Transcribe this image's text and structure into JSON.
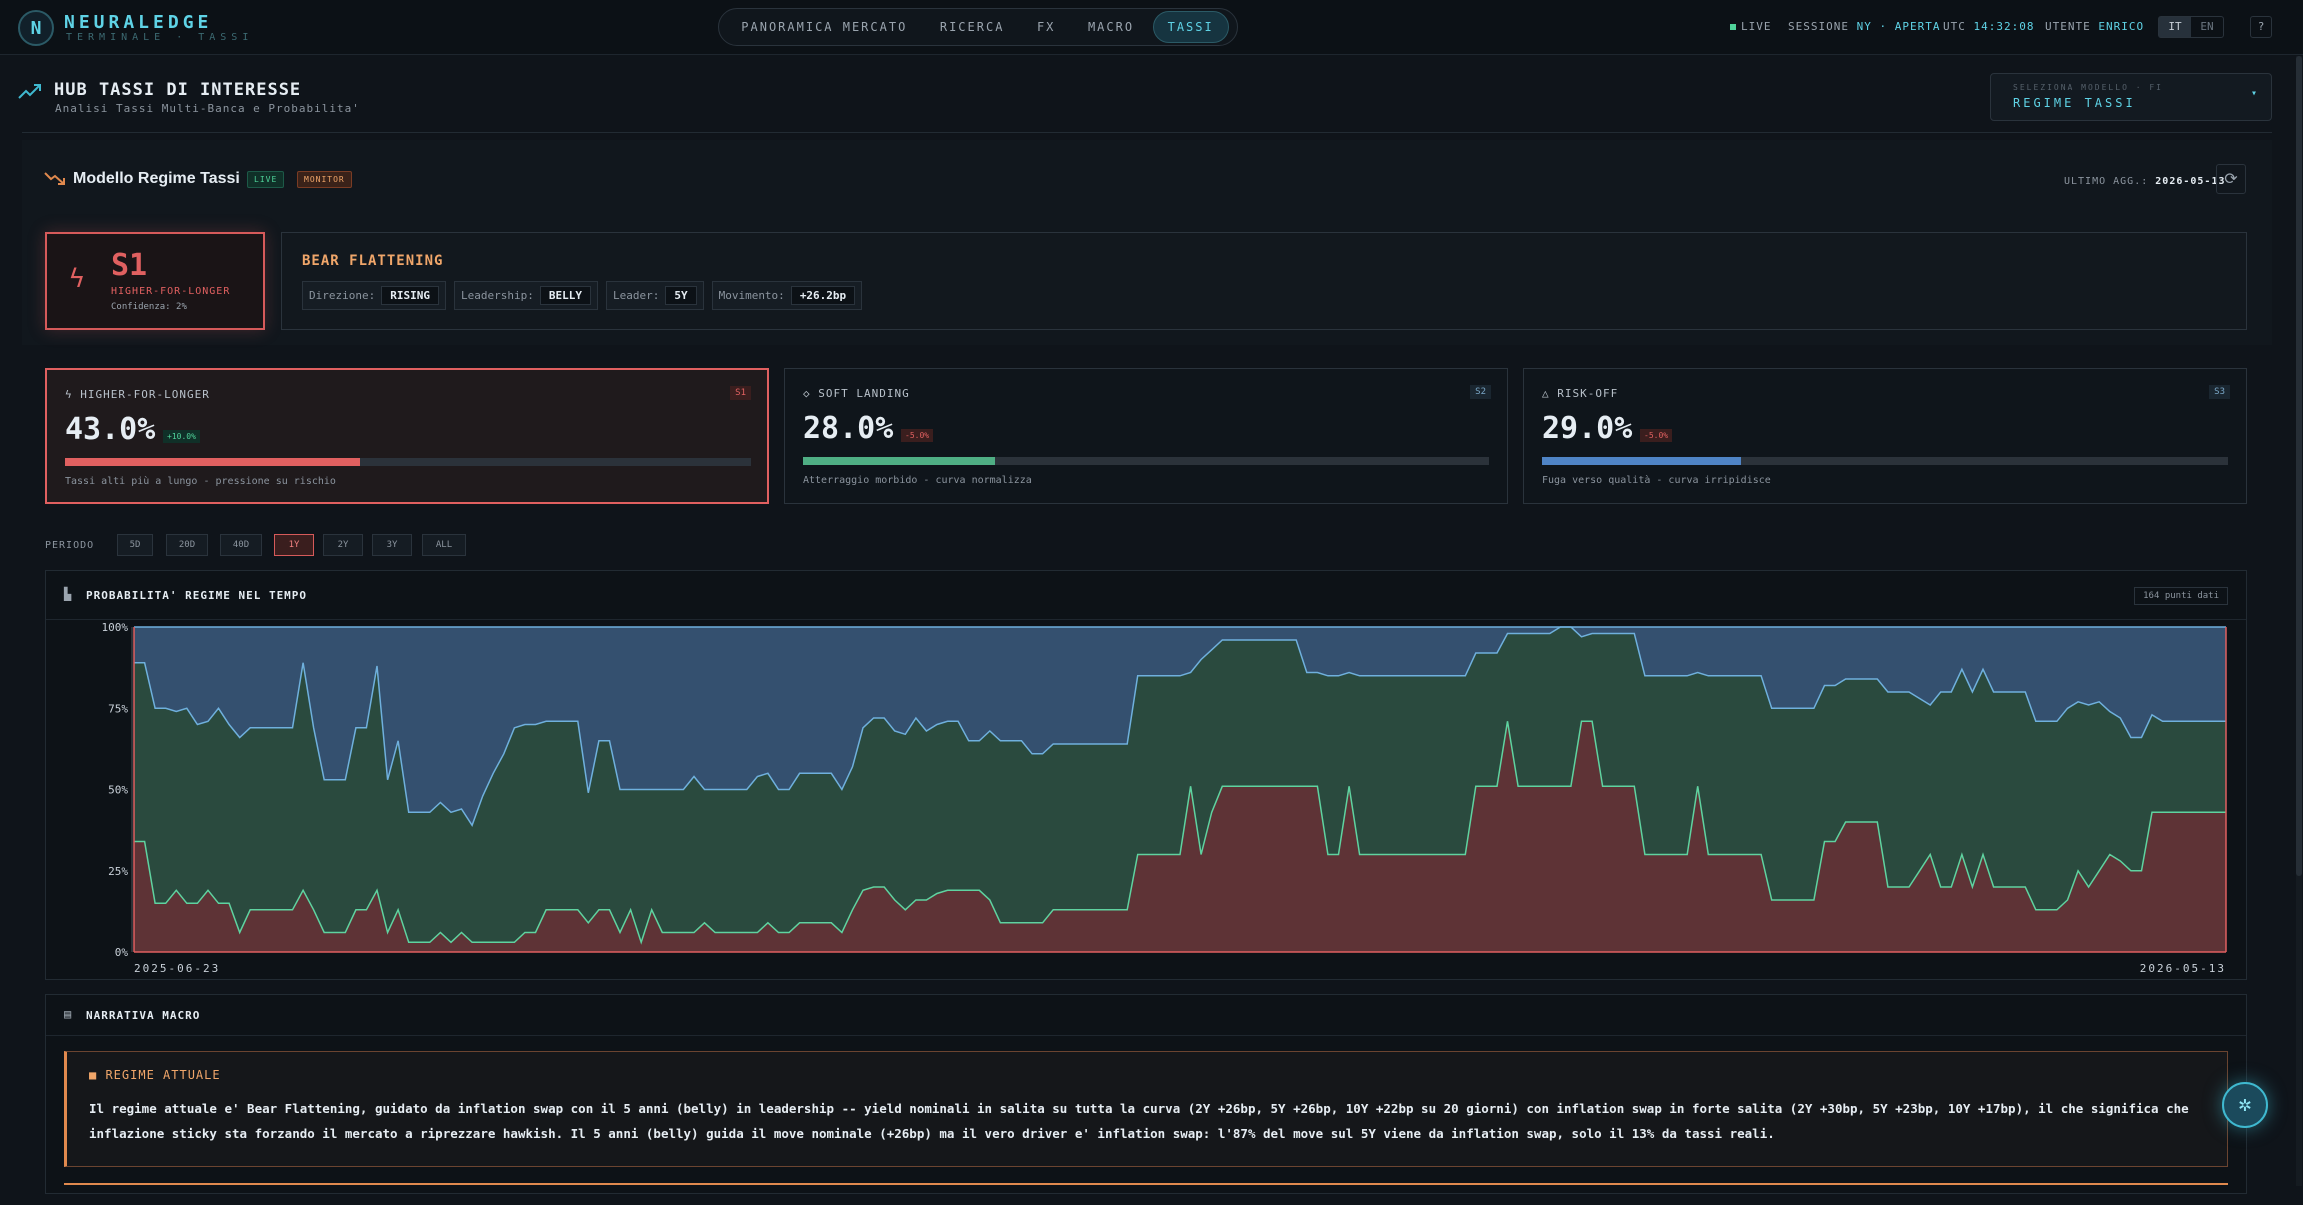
{
  "brand": {
    "name": "NEURALEDGE",
    "sub": "TERMINALE · TASSI",
    "logo": "N"
  },
  "nav": {
    "tabs": [
      "PANORAMICA MERCATO",
      "RICERCA",
      "FX",
      "MACRO",
      "TASSI"
    ],
    "active": "TASSI"
  },
  "status": {
    "live": "LIVE",
    "session_label": "SESSIONE",
    "session_value": "NY · APERTA",
    "utc_label": "UTC",
    "utc_value": "14:32:08",
    "user_label": "UTENTE",
    "user_value": "ENRICO",
    "lang_it": "IT",
    "lang_en": "EN",
    "help": "?"
  },
  "header": {
    "title": "HUB TASSI DI INTERESSE",
    "subtitle": "Analisi Tassi Multi-Banca e Probabilita'",
    "model_label": "SELEZIONA MODELLO · FI",
    "model_value": "REGIME TASSI"
  },
  "model": {
    "title": "Modello Regime Tassi",
    "badge_live": "LIVE",
    "badge_monitor": "MONITOR",
    "updated_label": "ULTIMO AGG.:",
    "updated_value": "2026-05-13"
  },
  "current": {
    "code": "S1",
    "name": "HIGHER-FOR-LONGER",
    "confidence": "Confidenza: 2%"
  },
  "shape": {
    "title": "BEAR FLATTENING",
    "pills": [
      {
        "label": "Direzione:",
        "value": "RISING"
      },
      {
        "label": "Leadership:",
        "value": "BELLY"
      },
      {
        "label": "Leader:",
        "value": "5Y"
      },
      {
        "label": "Movimento:",
        "value": "+26.2bp"
      }
    ]
  },
  "regimes": [
    {
      "name": "HIGHER-FOR-LONGER",
      "code": "S1",
      "value": "43.0%",
      "delta": "+10.0%",
      "fraction": 0.43,
      "desc": "Tassi alti più a lungo - pressione su rischio",
      "color": "#e06060"
    },
    {
      "name": "SOFT LANDING",
      "code": "S2",
      "value": "28.0%",
      "delta": "-5.0%",
      "fraction": 0.28,
      "desc": "Atterraggio morbido - curva normalizza",
      "color": "#4fae84"
    },
    {
      "name": "RISK-OFF",
      "code": "S3",
      "value": "29.0%",
      "delta": "-5.0%",
      "fraction": 0.29,
      "desc": "Fuga verso qualità - curva irripidisce",
      "color": "#4f84c6"
    }
  ],
  "periods": {
    "label": "PERIODO",
    "options": [
      "5D",
      "20D",
      "40D",
      "1Y",
      "2Y",
      "3Y",
      "ALL"
    ],
    "active": "1Y"
  },
  "chart": {
    "title": "PROBABILITA' REGIME NEL TEMPO",
    "count": "164 punti dati"
  },
  "chart_data": {
    "type": "area",
    "stacked": true,
    "x_start": "2025-06-23",
    "x_end": "2026-05-13",
    "yticks": [
      "0%",
      "25%",
      "50%",
      "75%",
      "100%"
    ],
    "ylim": [
      0,
      100
    ],
    "series": [
      {
        "color": "#e06060",
        "values": [
          34,
          34,
          15,
          15,
          19,
          15,
          15,
          19,
          15,
          15,
          6,
          13,
          13,
          13,
          13,
          13,
          19,
          13,
          6,
          6,
          6,
          13,
          13,
          19,
          6,
          13,
          3,
          3,
          3,
          6,
          3,
          6,
          3,
          3,
          3,
          3,
          3,
          6,
          6,
          13,
          13,
          13,
          13,
          9,
          13,
          13,
          6,
          13,
          3,
          13,
          6,
          6,
          6,
          6,
          9,
          6,
          6,
          6,
          6,
          6,
          9,
          6,
          6,
          9,
          9,
          9,
          9,
          6,
          13,
          19,
          20,
          20,
          16,
          13,
          16,
          16,
          18,
          19,
          19,
          19,
          19,
          16,
          9,
          9,
          9,
          9,
          9,
          13,
          13,
          13,
          13,
          13,
          13,
          13,
          13,
          30,
          30,
          30,
          30,
          30,
          51,
          30,
          43,
          51,
          51,
          51,
          51,
          51,
          51,
          51,
          51,
          51,
          51,
          30,
          30,
          51,
          30,
          30,
          30,
          30,
          30,
          30,
          30,
          30,
          30,
          30,
          30,
          51,
          51,
          51,
          71,
          51,
          51,
          51,
          51,
          51,
          51,
          71,
          71,
          51,
          51,
          51,
          51,
          30,
          30,
          30,
          30,
          30,
          51,
          30,
          30,
          30,
          30,
          30,
          30,
          16,
          16,
          16,
          16,
          16,
          34,
          34,
          40,
          40,
          40,
          40,
          20,
          20,
          20,
          25,
          30,
          20,
          20,
          30,
          20,
          30,
          20,
          20,
          20,
          20,
          13,
          13,
          13,
          16,
          25,
          20,
          25,
          30,
          28,
          25,
          25,
          43,
          43,
          43,
          43,
          43,
          43,
          43,
          43
        ]
      },
      {
        "color": "#4fae84",
        "values": [
          55,
          55,
          60,
          60,
          55,
          60,
          55,
          52,
          60,
          55,
          60,
          56,
          56,
          56,
          56,
          56,
          70,
          56,
          47,
          47,
          47,
          56,
          56,
          69,
          47,
          52,
          40,
          40,
          40,
          40,
          40,
          38,
          36,
          45,
          52,
          58,
          66,
          64,
          64,
          58,
          58,
          58,
          58,
          40,
          52,
          52,
          44,
          37,
          47,
          37,
          44,
          44,
          44,
          48,
          41,
          44,
          44,
          44,
          44,
          48,
          46,
          44,
          44,
          46,
          46,
          46,
          46,
          44,
          44,
          50,
          52,
          52,
          52,
          54,
          56,
          52,
          52,
          52,
          52,
          46,
          46,
          52,
          56,
          56,
          56,
          52,
          52,
          51,
          51,
          51,
          51,
          51,
          51,
          51,
          51,
          55,
          55,
          55,
          55,
          55,
          35,
          60,
          50,
          45,
          45,
          45,
          45,
          45,
          45,
          45,
          45,
          35,
          35,
          55,
          55,
          35,
          55,
          55,
          55,
          55,
          55,
          55,
          55,
          55,
          55,
          55,
          55,
          41,
          41,
          41,
          27,
          47,
          47,
          47,
          47,
          49,
          49,
          26,
          27,
          47,
          47,
          47,
          47,
          55,
          55,
          55,
          55,
          55,
          35,
          55,
          55,
          55,
          55,
          55,
          55,
          59,
          59,
          59,
          59,
          59,
          48,
          48,
          44,
          44,
          44,
          44,
          60,
          60,
          60,
          53,
          46,
          60,
          60,
          57,
          60,
          57,
          60,
          60,
          60,
          60,
          58,
          58,
          58,
          59,
          52,
          56,
          52,
          44,
          44,
          41,
          41,
          30,
          28,
          28,
          28,
          28,
          28,
          28,
          28
        ]
      }
    ]
  },
  "narrative": {
    "title": "NARRATIVA MACRO",
    "regime_title": "REGIME ATTUALE",
    "regime_text": "Il regime attuale e' Bear Flattening, guidato da inflation swap con il 5 anni (belly) in leadership -- yield nominali in salita su tutta la curva (2Y +26bp, 5Y +26bp, 10Y +22bp su 20 giorni) con inflation swap in forte salita (2Y +30bp, 5Y +23bp, 10Y +17bp), il che significa che inflazione sticky sta forzando il mercato a riprezzare hawkish. Il 5 anni (belly) guida il move nominale (+26bp) ma il vero driver e' inflation swap: l'87% del move sul 5Y viene da inflation swap, solo il 13% da tassi reali."
  }
}
